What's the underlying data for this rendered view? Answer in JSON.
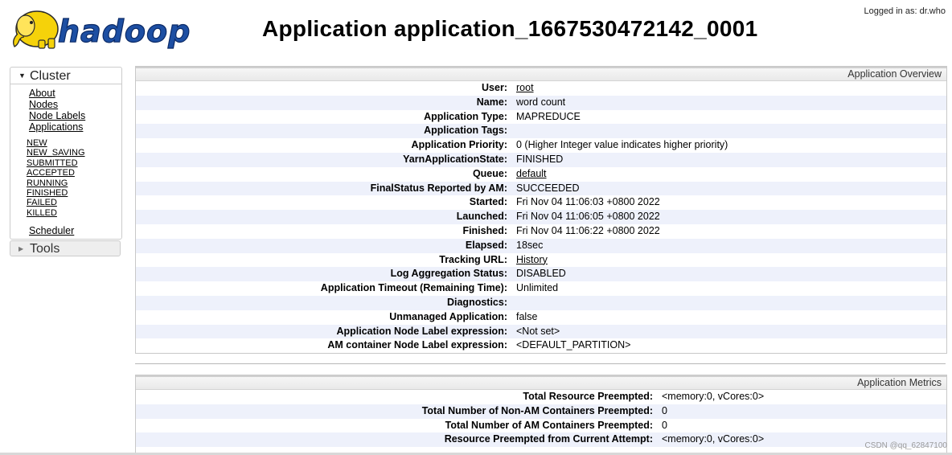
{
  "header": {
    "logo_text": "hadoop",
    "title": "Application application_1667530472142_0001",
    "logged_in": "Logged in as: dr.who"
  },
  "nav": {
    "cluster_label": "Cluster",
    "cluster_links": [
      "About",
      "Nodes",
      "Node Labels",
      "Applications"
    ],
    "app_states": [
      "NEW",
      "NEW_SAVING",
      "SUBMITTED",
      "ACCEPTED",
      "RUNNING",
      "FINISHED",
      "FAILED",
      "KILLED"
    ],
    "scheduler_label": "Scheduler",
    "tools_label": "Tools"
  },
  "overview": {
    "title": "Application Overview",
    "rows": [
      {
        "k": "User:",
        "v": "root",
        "link": true
      },
      {
        "k": "Name:",
        "v": "word count"
      },
      {
        "k": "Application Type:",
        "v": "MAPREDUCE"
      },
      {
        "k": "Application Tags:",
        "v": ""
      },
      {
        "k": "Application Priority:",
        "v": "0 (Higher Integer value indicates higher priority)"
      },
      {
        "k": "YarnApplicationState:",
        "v": "FINISHED"
      },
      {
        "k": "Queue:",
        "v": "default",
        "link": true
      },
      {
        "k": "FinalStatus Reported by AM:",
        "v": "SUCCEEDED"
      },
      {
        "k": "Started:",
        "v": "Fri Nov 04 11:06:03 +0800 2022"
      },
      {
        "k": "Launched:",
        "v": "Fri Nov 04 11:06:05 +0800 2022"
      },
      {
        "k": "Finished:",
        "v": "Fri Nov 04 11:06:22 +0800 2022"
      },
      {
        "k": "Elapsed:",
        "v": "18sec"
      },
      {
        "k": "Tracking URL:",
        "v": "History",
        "link": true
      },
      {
        "k": "Log Aggregation Status:",
        "v": "DISABLED"
      },
      {
        "k": "Application Timeout (Remaining Time):",
        "v": "Unlimited"
      },
      {
        "k": "Diagnostics:",
        "v": ""
      },
      {
        "k": "Unmanaged Application:",
        "v": "false"
      },
      {
        "k": "Application Node Label expression:",
        "v": "<Not set>"
      },
      {
        "k": "AM container Node Label expression:",
        "v": "<DEFAULT_PARTITION>"
      }
    ]
  },
  "metrics": {
    "title": "Application Metrics",
    "rows": [
      {
        "k": "Total Resource Preempted:",
        "v": "<memory:0, vCores:0>"
      },
      {
        "k": "Total Number of Non-AM Containers Preempted:",
        "v": "0"
      },
      {
        "k": "Total Number of AM Containers Preempted:",
        "v": "0"
      },
      {
        "k": "Resource Preempted from Current Attempt:",
        "v": "<memory:0, vCores:0>"
      }
    ]
  },
  "watermark": "CSDN @qq_62847100",
  "colors": {
    "logo_yellow": "#f5d20a",
    "logo_blue": "#1d4fa3",
    "row_stripe": "#eef1fb"
  }
}
